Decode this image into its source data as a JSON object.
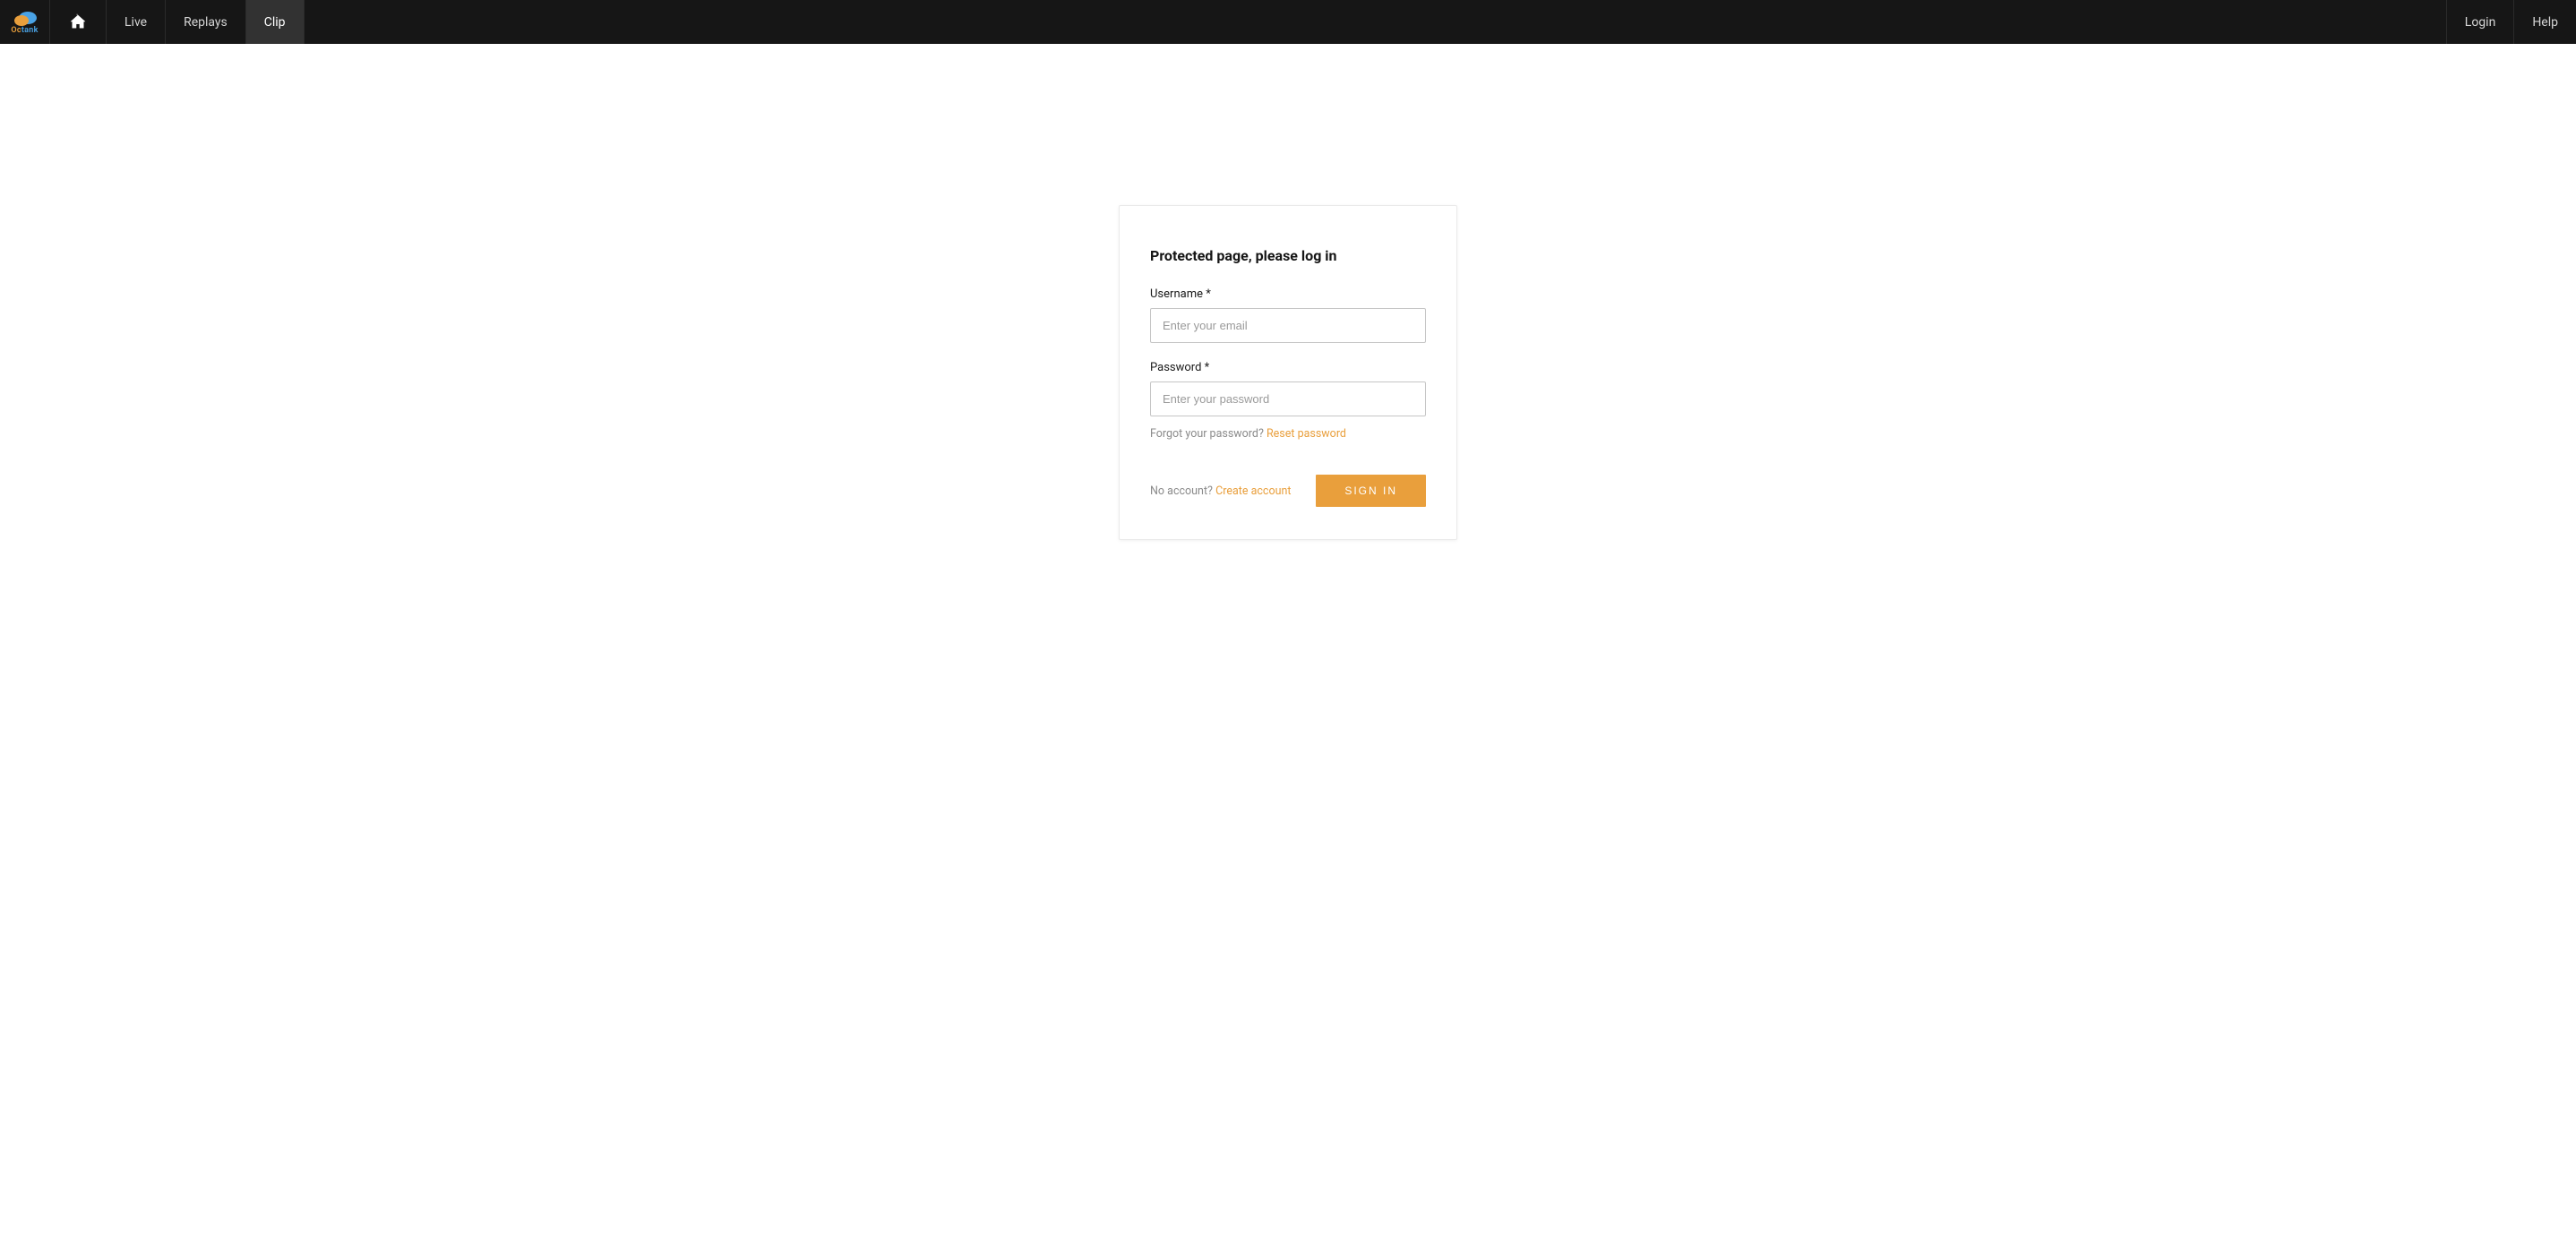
{
  "brand": {
    "oc": "Oc",
    "tank": "tank"
  },
  "nav": {
    "left": [
      {
        "key": "live",
        "label": "Live",
        "active": false
      },
      {
        "key": "replays",
        "label": "Replays",
        "active": false
      },
      {
        "key": "clip",
        "label": "Clip",
        "active": true
      }
    ],
    "right": [
      {
        "key": "login",
        "label": "Login"
      },
      {
        "key": "help",
        "label": "Help"
      }
    ]
  },
  "login": {
    "title": "Protected page, please log in",
    "username_label": "Username *",
    "username_placeholder": "Enter your email",
    "password_label": "Password *",
    "password_placeholder": "Enter your password",
    "forgot_prefix": "Forgot your password? ",
    "reset_link": "Reset password",
    "no_account_prefix": "No account? ",
    "create_link": "Create account",
    "signin_label": "SIGN IN"
  },
  "colors": {
    "accent": "#e99f3c"
  }
}
